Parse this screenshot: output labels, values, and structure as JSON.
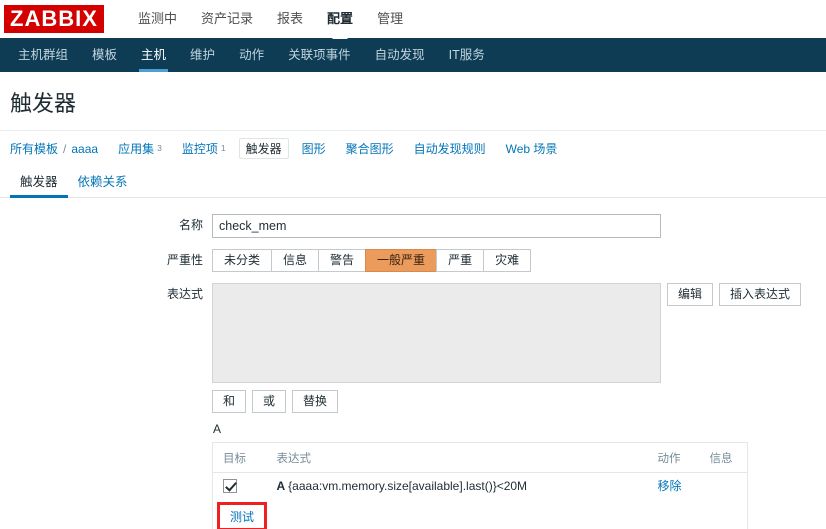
{
  "brand": {
    "logo_text": "ZABBIX",
    "logo_bg": "#D40000"
  },
  "main_menu": [
    {
      "label": "监测中",
      "selected": false
    },
    {
      "label": "资产记录",
      "selected": false
    },
    {
      "label": "报表",
      "selected": false
    },
    {
      "label": "配置",
      "selected": true
    },
    {
      "label": "管理",
      "selected": false
    }
  ],
  "sub_menu": [
    {
      "label": "主机群组",
      "selected": false
    },
    {
      "label": "模板",
      "selected": false
    },
    {
      "label": "主机",
      "selected": true
    },
    {
      "label": "维护",
      "selected": false
    },
    {
      "label": "动作",
      "selected": false
    },
    {
      "label": "关联项事件",
      "selected": false
    },
    {
      "label": "自动发现",
      "selected": false
    },
    {
      "label": "IT服务",
      "selected": false
    }
  ],
  "page": {
    "title": "触发器"
  },
  "breadcrumb": {
    "root": "所有模板",
    "separator": "/",
    "host": "aaaa",
    "items": [
      {
        "label": "应用集",
        "count": "3",
        "current": false
      },
      {
        "label": "监控项",
        "count": "1",
        "current": false
      },
      {
        "label": "触发器",
        "count": "",
        "current": true
      },
      {
        "label": "图形",
        "count": "",
        "current": false
      },
      {
        "label": "聚合图形",
        "count": "",
        "current": false
      },
      {
        "label": "自动发现规则",
        "count": "",
        "current": false
      },
      {
        "label": "Web 场景",
        "count": "",
        "current": false
      }
    ]
  },
  "tabs": [
    {
      "label": "触发器",
      "active": true
    },
    {
      "label": "依赖关系",
      "active": false
    }
  ],
  "form": {
    "name_label": "名称",
    "name_value": "check_mem",
    "name_placeholder": "",
    "severity_label": "严重性",
    "severity_options": [
      {
        "label": "未分类",
        "active": false
      },
      {
        "label": "信息",
        "active": false
      },
      {
        "label": "警告",
        "active": false
      },
      {
        "label": "一般严重",
        "active": true
      },
      {
        "label": "严重",
        "active": false
      },
      {
        "label": "灾难",
        "active": false
      }
    ],
    "severity_active_color": "#eb9b5b",
    "expression_label": "表达式",
    "expression_value": "",
    "expression_placeholder": "",
    "edit_button": "编辑",
    "insert_expression_button": "插入表达式",
    "operator_buttons": [
      {
        "label": "和"
      },
      {
        "label": "或"
      },
      {
        "label": "替换"
      }
    ],
    "group_label": "A"
  },
  "expression_table": {
    "headers": {
      "target": "目标",
      "expression": "表达式",
      "action": "动作",
      "info": "信息"
    },
    "rows": [
      {
        "checked": true,
        "prefix": "A",
        "expression": "{aaaa:vm.memory.size[available].last()}<20M",
        "action": "移除",
        "info": ""
      }
    ],
    "test_button": "测试",
    "test_highlight_color": "#f02020"
  }
}
